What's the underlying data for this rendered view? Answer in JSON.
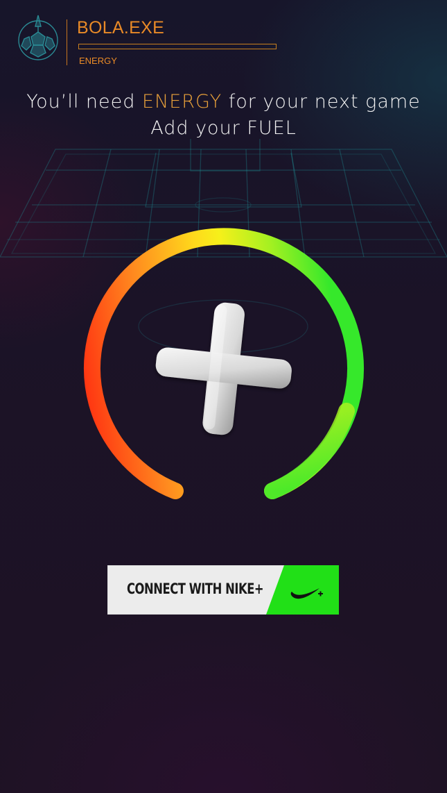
{
  "header": {
    "app_title": "BOLA.EXE",
    "energy_label": "ENERGY",
    "energy_level": 1.0
  },
  "headline": {
    "line1_prefix": "You’ll need ",
    "line1_highlight": "ENERGY",
    "line1_suffix": " for your next game",
    "line2": "Add your FUEL"
  },
  "gauge": {
    "icon": "plus-icon",
    "gradient_colors": [
      "#ff2a10",
      "#ff8a1f",
      "#ffd81c",
      "#f6f01a",
      "#a6f021",
      "#36e82b"
    ]
  },
  "connect_button": {
    "label": "CONNECT WITH NIKE+",
    "icon": "nike-swoosh-plus-icon",
    "accent_color": "#21e017"
  },
  "colors": {
    "accent_orange": "#e98a27",
    "logo_teal": "#2a8a94"
  }
}
